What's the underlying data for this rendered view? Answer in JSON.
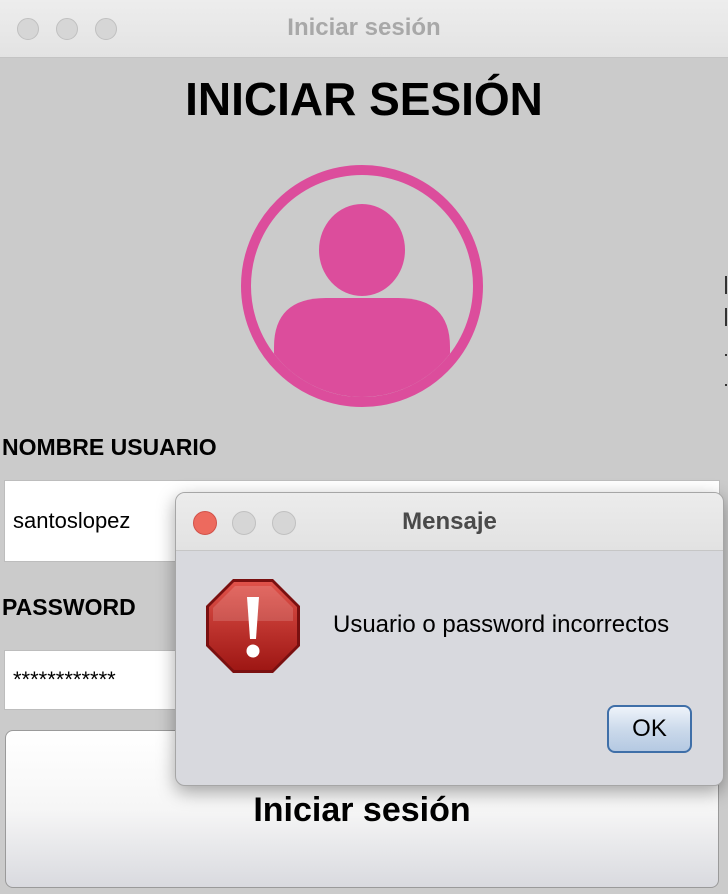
{
  "window": {
    "title": "Iniciar sesión"
  },
  "form": {
    "heading": "INICIAR SESIÓN",
    "username_label": "NOMBRE USUARIO",
    "username_value": "santoslopez",
    "password_label": "PASSWORD",
    "password_value": "************",
    "submit_label": "Iniciar sesión",
    "avatar_icon": "user-avatar-icon",
    "avatar_color": "#dc4d9c"
  },
  "dialog": {
    "title": "Mensaje",
    "message": "Usuario o password incorrectos",
    "ok_label": "OK",
    "icon": "error-stop-icon",
    "icon_color": "#b82321"
  }
}
